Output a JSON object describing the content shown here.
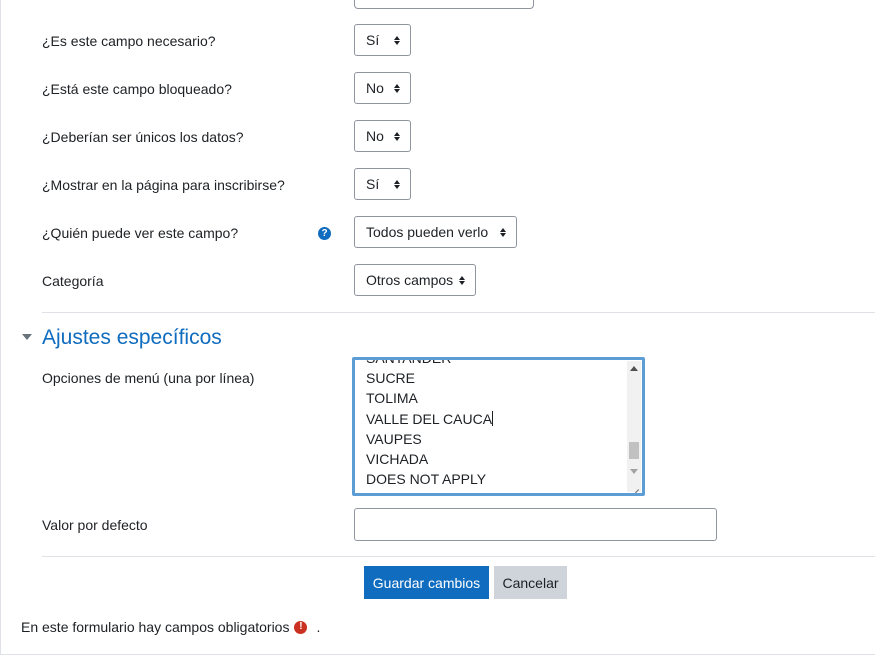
{
  "fields": [
    {
      "label": "¿Es este campo necesario?",
      "value": "Sí"
    },
    {
      "label": "¿Está este campo bloqueado?",
      "value": "No"
    },
    {
      "label": "¿Deberían ser únicos los datos?",
      "value": "No"
    },
    {
      "label": "¿Mostrar en la página para inscribirse?",
      "value": "Sí"
    },
    {
      "label": "¿Quién puede ver este campo?",
      "value": "Todos pueden verlo",
      "has_help": true
    },
    {
      "label": "Categoría",
      "value": "Otros campos"
    }
  ],
  "section": {
    "title": "Ajustes específicos"
  },
  "menu_options": {
    "label": "Opciones de menú (una por línea)",
    "partial_line": "SANTANDER",
    "lines": [
      "SUCRE",
      "TOLIMA",
      "VALLE DEL CAUCA",
      "VAUPES",
      "VICHADA",
      "DOES NOT APPLY"
    ]
  },
  "default_value": {
    "label": "Valor por defecto",
    "value": ""
  },
  "buttons": {
    "save": "Guardar cambios",
    "cancel": "Cancelar"
  },
  "required_note": {
    "text": "En este formulario hay campos obligatorios",
    "suffix": "."
  },
  "colors": {
    "primary": "#0f6cbf",
    "focus": "#5d9dd6",
    "required": "#ca3120",
    "border": "#8f959e"
  }
}
